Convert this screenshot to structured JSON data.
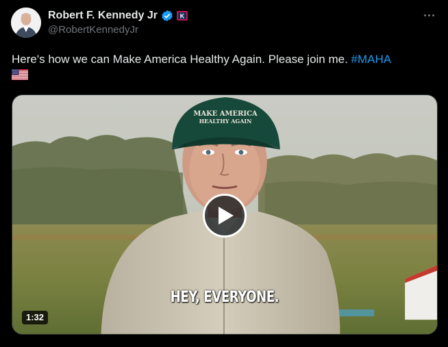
{
  "author": {
    "display_name": "Robert F. Kennedy Jr",
    "handle": "@RobertKennedyJr",
    "avatar_icon": "profile-photo",
    "verified_icon": "verified-badge-icon",
    "affiliate_icon": "affiliate-badge-icon"
  },
  "tweet": {
    "text": "Here's how we can Make America Healthy Again. Please join me. ",
    "hashtag": "#MAHA",
    "emoji": "us-flag-emoji"
  },
  "media": {
    "caption": "HEY, EVERYONE.",
    "duration": "1:32",
    "play_icon": "play-icon",
    "hat_text": "MAKE AMERICA HEALTHY AGAIN"
  },
  "colors": {
    "background": "#000000",
    "text": "#e7e9ea",
    "secondary": "#71767b",
    "link": "#1d9bf0",
    "verified": "#1d9bf0"
  }
}
